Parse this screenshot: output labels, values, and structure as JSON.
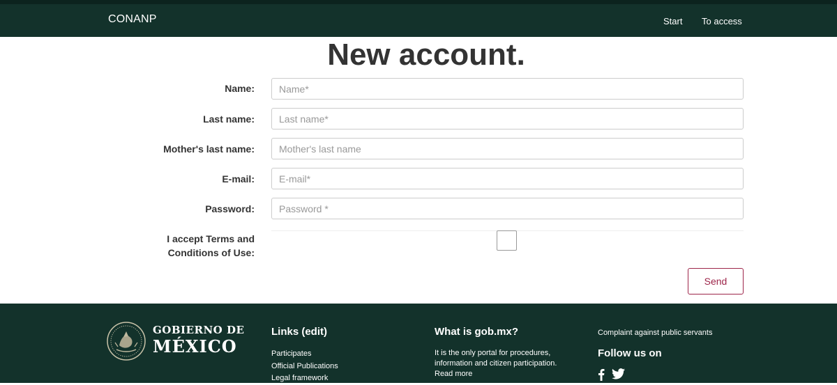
{
  "navbar": {
    "brand": "CONANP",
    "links": [
      {
        "label": "Start"
      },
      {
        "label": "To access"
      }
    ]
  },
  "page": {
    "title": "New account."
  },
  "form": {
    "fields": [
      {
        "label": "Name:",
        "placeholder": "Name*",
        "value": ""
      },
      {
        "label": "Last name:",
        "placeholder": "Last name*",
        "value": ""
      },
      {
        "label": "Mother's last name:",
        "placeholder": "Mother's last name",
        "value": ""
      },
      {
        "label": "E-mail:",
        "placeholder": "E-mail*",
        "value": ""
      },
      {
        "label": "Password:",
        "placeholder": "Password *",
        "value": ""
      }
    ],
    "terms_label_line1": "I accept Terms and",
    "terms_label_line2": "Conditions of Use:",
    "terms_checked": false,
    "send_label": "Send"
  },
  "footer": {
    "gov_top": "GOBIERNO DE",
    "gov_bottom": "MÉXICO",
    "links_heading": "Links (edit)",
    "links": [
      {
        "label": "Participates"
      },
      {
        "label": "Official Publications"
      },
      {
        "label": "Legal framework"
      }
    ],
    "gob_heading": "What is gob.mx?",
    "gob_line1": "It is the only portal for procedures,",
    "gob_line2": "information and citizen participation.",
    "read_more": "Read more",
    "complaint": "Complaint against public servants",
    "follow_heading": "Follow us on",
    "social": [
      {
        "icon": "facebook-icon"
      },
      {
        "icon": "twitter-icon"
      }
    ]
  },
  "colors": {
    "header_bg": "#13322b",
    "accent": "#9d2449",
    "text": "#333333"
  }
}
